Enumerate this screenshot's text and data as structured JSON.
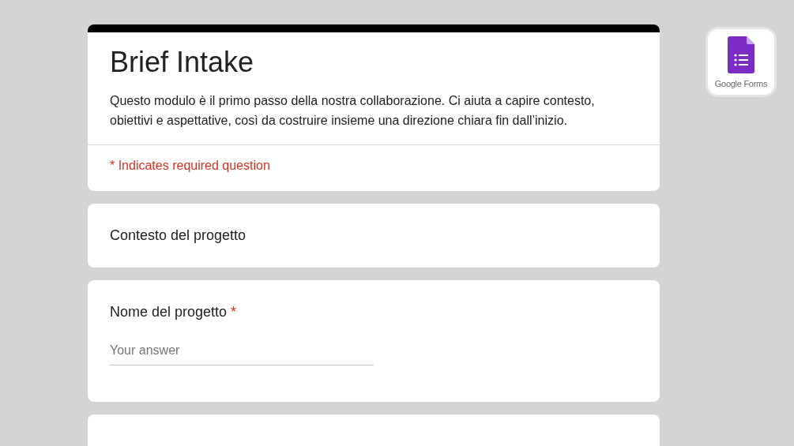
{
  "form": {
    "title": "Brief Intake",
    "description": "Questo modulo è il primo passo della nostra collaborazione. Ci aiuta a capire contesto, obiettivi e aspettative, così da costruire insieme una direzione chiara fin dall’inizio.",
    "required_note": "* Indicates required question"
  },
  "sections": [
    {
      "kind": "heading",
      "title": "Contesto del progetto"
    },
    {
      "kind": "text_question",
      "title": "Nome del progetto",
      "required_mark": "*",
      "placeholder": "Your answer"
    },
    {
      "kind": "blank"
    }
  ],
  "badge": {
    "label": "Google Forms"
  }
}
